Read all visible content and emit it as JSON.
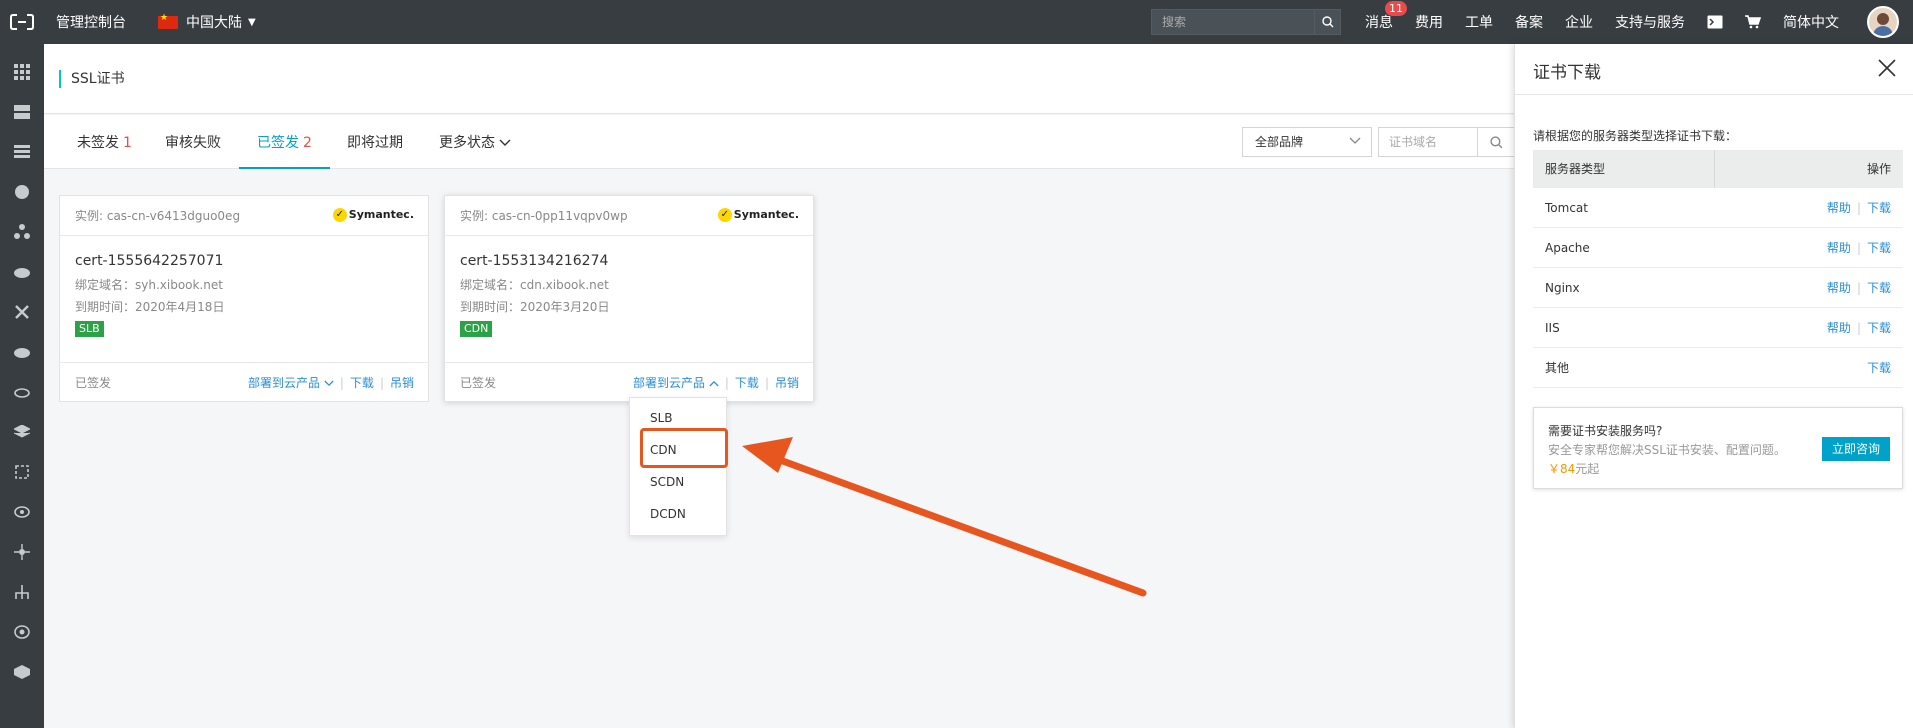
{
  "topbar": {
    "console": "管理控制台",
    "region": "中国大陆",
    "search_placeholder": "搜索",
    "links": {
      "messages": "消息",
      "messages_badge": "11",
      "fees": "费用",
      "tickets": "工单",
      "icp": "备案",
      "enterprise": "企业",
      "support": "支持与服务",
      "lang": "简体中文"
    }
  },
  "page": {
    "title": "SSL证书",
    "tabs": [
      {
        "label": "未签发",
        "count": "1"
      },
      {
        "label": "审核失败",
        "count": ""
      },
      {
        "label": "已签发",
        "count": "2"
      },
      {
        "label": "即将过期",
        "count": ""
      },
      {
        "label": "更多状态",
        "count": ""
      }
    ],
    "brand_select": "全部品牌",
    "domain_placeholder": "证书域名"
  },
  "cards": [
    {
      "instance": "实例: cas-cn-v6413dguo0eg",
      "brand": "Symantec.",
      "name": "cert-1555642257071",
      "domain": "绑定域名：syh.xibook.net",
      "expire": "到期时间：2020年4月18日",
      "tag": "SLB",
      "status": "已签发",
      "deploy": "部署到云产品",
      "download": "下载",
      "revoke": "吊销"
    },
    {
      "instance": "实例: cas-cn-0pp11vqpv0wp",
      "brand": "Symantec.",
      "name": "cert-1553134216274",
      "domain": "绑定域名：cdn.xibook.net",
      "expire": "到期时间：2020年3月20日",
      "tag": "CDN",
      "status": "已签发",
      "deploy": "部署到云产品",
      "download": "下载",
      "revoke": "吊销"
    }
  ],
  "dropdown": [
    "SLB",
    "CDN",
    "SCDN",
    "DCDN"
  ],
  "panel": {
    "title": "证书下载",
    "hint": "请根据您的服务器类型选择证书下载：",
    "col_server": "服务器类型",
    "col_ops": "操作",
    "help": "帮助",
    "download": "下载",
    "rows": [
      "Tomcat",
      "Apache",
      "Nginx",
      "IIS",
      "其他"
    ],
    "promo_title": "需要证书安装服务吗?",
    "promo_text": "安全专家帮您解决SSL证书安装、配置问题。",
    "promo_price": "￥84",
    "promo_unit": "元起",
    "promo_btn": "立即咨询"
  },
  "colors": {
    "topbar": "#373d41",
    "accent": "#00a2ca",
    "link": "#2a8ed6",
    "tag_green": "#2ba245",
    "arrow": "#e8561f"
  }
}
